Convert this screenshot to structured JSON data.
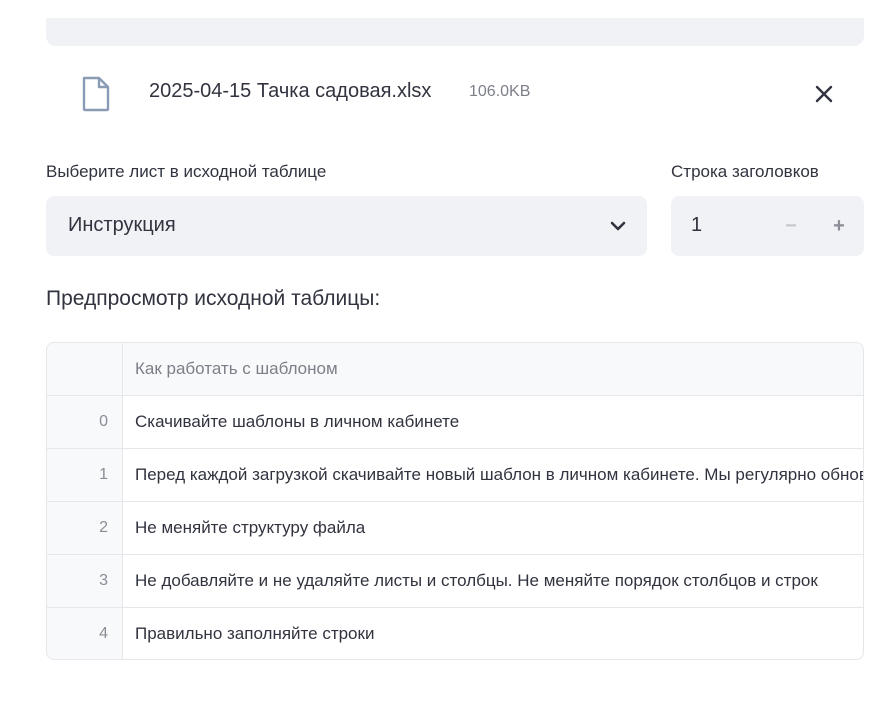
{
  "file": {
    "name": "2025-04-15 Тачка садовая.xlsx",
    "size": "106.0KB",
    "icon": "file-icon"
  },
  "sheet_select": {
    "label": "Выберите лист в исходной таблице",
    "value": "Инструкция"
  },
  "header_row": {
    "label": "Строка заголовков",
    "value": "1",
    "minus": "−",
    "plus": "+"
  },
  "preview": {
    "title": "Предпросмотр исходной таблицы:",
    "column_header": "Как работать с шаблоном",
    "rows": [
      {
        "index": "0",
        "value": "Скачивайте шаблоны в личном кабинете"
      },
      {
        "index": "1",
        "value": "Перед каждой загрузкой скачивайте новый шаблон в личном кабинете. Мы регулярно обновляем шаблоны"
      },
      {
        "index": "2",
        "value": "Не меняйте структуру файла"
      },
      {
        "index": "3",
        "value": "Не добавляйте и не удаляйте листы и столбцы. Не меняйте порядок столбцов и строк"
      },
      {
        "index": "4",
        "value": "Правильно заполняйте строки"
      }
    ]
  }
}
